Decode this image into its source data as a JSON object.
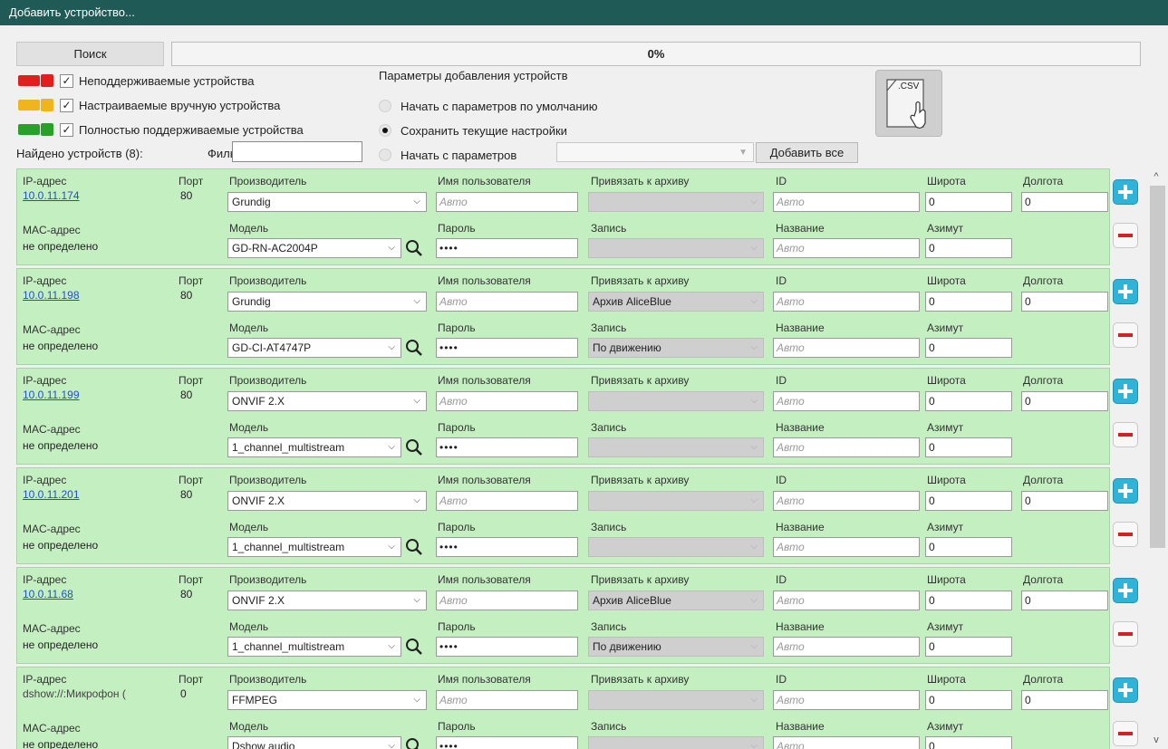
{
  "window": {
    "title": "Добавить устройство..."
  },
  "toolbar": {
    "search_label": "Поиск",
    "progress_text": "0%"
  },
  "legend": {
    "unsupported": {
      "label": "Неподдерживаемые устройства",
      "checked": "✓",
      "color": "#e0201c"
    },
    "manual": {
      "label": "Настраиваемые вручную устройства",
      "checked": "✓",
      "color": "#f0b41c"
    },
    "full": {
      "label": "Полностью поддерживаемые устройства",
      "checked": "✓",
      "color": "#2aa02a"
    }
  },
  "params": {
    "title": "Параметры добавления устройств",
    "option_default": "Начать с параметров по умолчанию",
    "option_keep": "Сохранить текущие настройки",
    "option_from": "Начать с параметров",
    "selected": "option_keep"
  },
  "csv": {
    "label": ".CSV"
  },
  "found_label": "Найдено устройств (8):",
  "filter": {
    "label": "Фильтр:",
    "value": ""
  },
  "add_all_label": "Добавить все",
  "labels": {
    "ip": "IP-адрес",
    "port": "Порт",
    "mac": "MAC-адрес",
    "mac_value": "не определено",
    "manufacturer": "Производитель",
    "model": "Модель",
    "user": "Имя пользователя",
    "password": "Пароль",
    "archive": "Привязать к архиву",
    "record": "Запись",
    "id": "ID",
    "name": "Название",
    "lat": "Широта",
    "lon": "Долгота",
    "azimuth": "Азимут",
    "auto": "Авто",
    "password_mask": "••••",
    "zero": "0"
  },
  "devices": [
    {
      "ip": "10.0.11.174",
      "port": "80",
      "manufacturer": "Grundig",
      "model": "GD-RN-AC2004P",
      "archive": "",
      "record": ""
    },
    {
      "ip": "10.0.11.198",
      "port": "80",
      "manufacturer": "Grundig",
      "model": "GD-CI-AT4747P",
      "archive": "Архив AliceBlue",
      "record": "По движению"
    },
    {
      "ip": "10.0.11.199",
      "port": "80",
      "manufacturer": "ONVIF 2.X",
      "model": "1_channel_multistream",
      "archive": "",
      "record": ""
    },
    {
      "ip": "10.0.11.201",
      "port": "80",
      "manufacturer": "ONVIF 2.X",
      "model": "1_channel_multistream",
      "archive": "",
      "record": ""
    },
    {
      "ip": "10.0.11.68",
      "port": "80",
      "manufacturer": "ONVIF 2.X",
      "model": "1_channel_multistream",
      "archive": "Архив AliceBlue",
      "record": "По движению"
    },
    {
      "ip": "dshow://:Микрофон (",
      "port": "0",
      "manufacturer": "FFMPEG",
      "model": "Dshow audio",
      "archive": "",
      "record": ""
    }
  ]
}
